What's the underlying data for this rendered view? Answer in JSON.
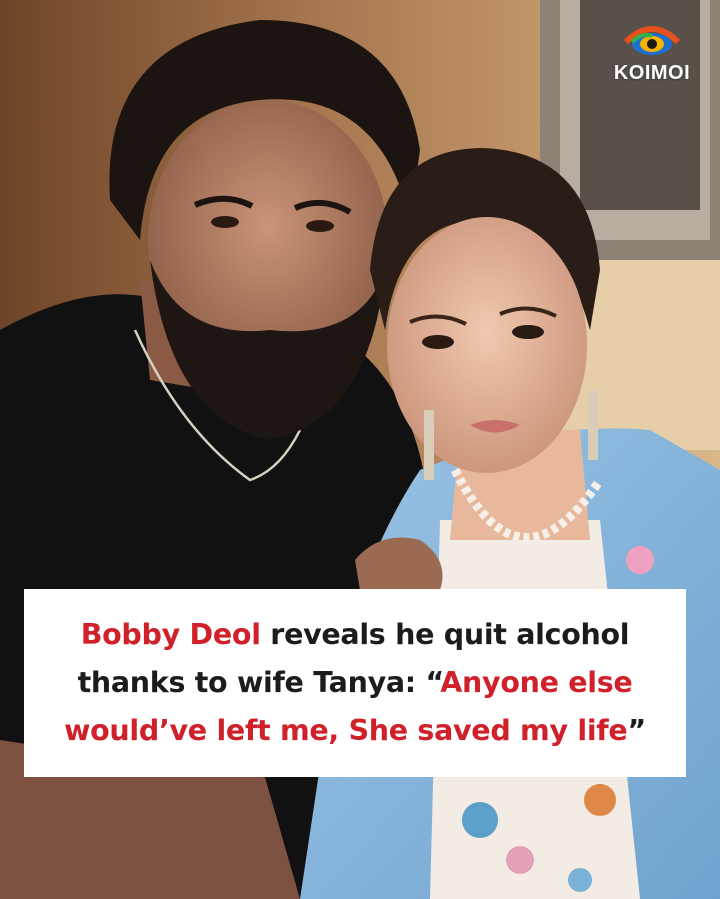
{
  "brand": {
    "name": "KOIMOI",
    "logo_icon": "koimoi-eye-logo-icon"
  },
  "caption": {
    "line1_highlight": "Bobby Deol",
    "line1_rest": " reveals he quit alcohol",
    "line2_plain": "thanks to wife Tanya: “",
    "line2_highlight": "Anyone else",
    "line3_highlight": "would’ve left me, She saved my life",
    "line3_close": "”"
  },
  "colors": {
    "highlight": "#d0202a",
    "text": "#1c1c1c",
    "card": "#ffffff"
  }
}
